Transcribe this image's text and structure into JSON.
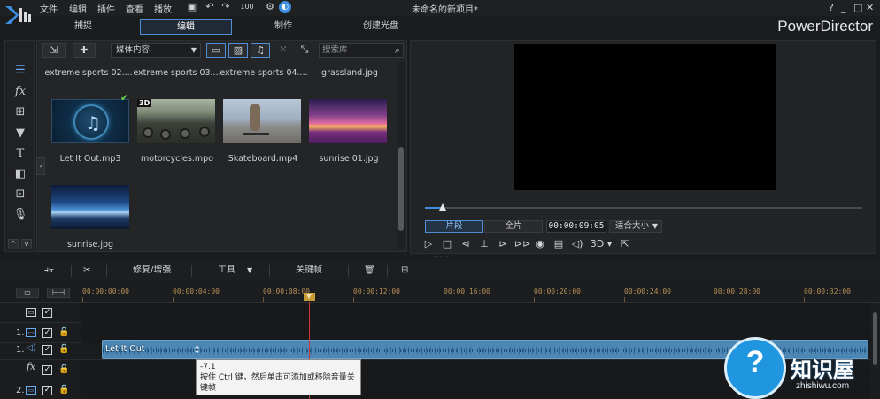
{
  "menu": {
    "items": [
      "文件",
      "编辑",
      "插件",
      "查看",
      "播放"
    ],
    "zoom_label": "100",
    "window_title": "未命名的新项目*",
    "controls": [
      "?",
      "_",
      "□",
      "✕"
    ]
  },
  "modes": {
    "tabs": [
      "捕捉",
      "编辑",
      "制作",
      "创建光盘"
    ],
    "active": "编辑",
    "app_name": "PowerDirector"
  },
  "library": {
    "filter_select": "媒体内容",
    "search_placeholder": "搜索库",
    "top_row_labels": [
      "extreme sports 02....",
      "extreme sports 03....",
      "extreme sports 04....",
      "grassland.jpg"
    ],
    "items": [
      {
        "label": "Let It Out.mp3",
        "type": "audio"
      },
      {
        "label": "motorcycles.mpo",
        "type": "3d-video",
        "badge": "3D"
      },
      {
        "label": "Skateboard.mp4",
        "type": "video"
      },
      {
        "label": "sunrise 01.jpg",
        "type": "image"
      },
      {
        "label": "sunrise.jpg",
        "type": "image"
      }
    ]
  },
  "preview": {
    "mode_clip": "片段",
    "mode_movie": "全片",
    "timecode": "00:00:09:05",
    "fit_select": "适合大小",
    "three_d_label": "3D"
  },
  "timeline_toolbar": {
    "repair_label": "修复/增强",
    "tools_label": "工具",
    "keyframe_label": "关键帧"
  },
  "ruler": {
    "ticks": [
      "00:00:00:00",
      "00:00:04:00",
      "00:00:08:00",
      "00:00:12:00",
      "00:00:16:00",
      "00:00:20:00",
      "00:00:24:00",
      "00:00:28:00",
      "00:00:32:00"
    ]
  },
  "tracks": [
    {
      "num": "",
      "kind": "master"
    },
    {
      "num": "1.",
      "kind": "video"
    },
    {
      "num": "1.",
      "kind": "audio"
    },
    {
      "num": "",
      "kind": "fx",
      "label": "fx"
    },
    {
      "num": "2.",
      "kind": "video"
    }
  ],
  "clip": {
    "label": "Let It Out",
    "color": "#4d87b4"
  },
  "tooltip": {
    "value": "-7.1",
    "text": "按住 Ctrl 键，然后单击可添加或移除音量关键帧"
  },
  "watermark": {
    "title": "知识屋",
    "subtitle": "zhishiwu.com",
    "glyph": "?"
  },
  "colors": {
    "accent": "#4f8fd4",
    "playhead": "#d3333a",
    "ruler_text": "#b48f57"
  }
}
